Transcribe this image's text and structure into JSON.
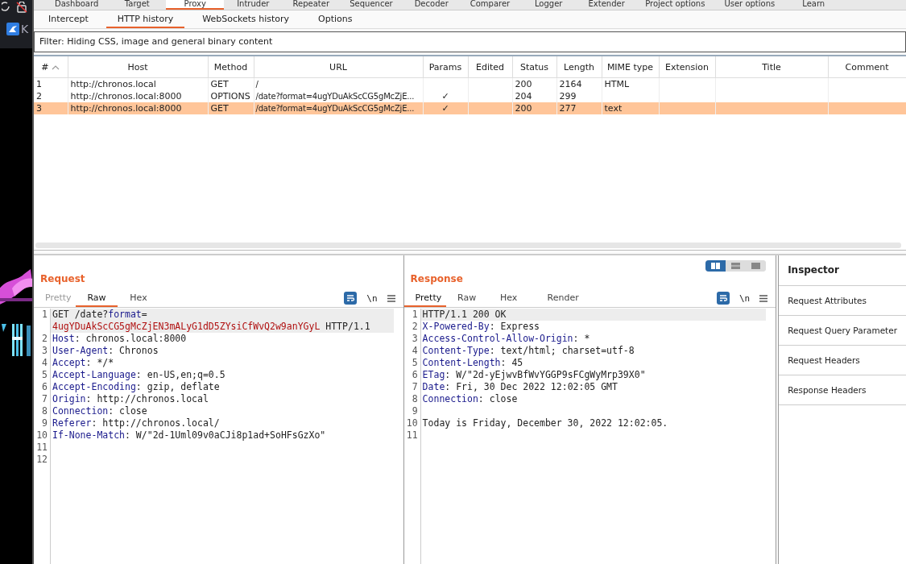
{
  "desktop": {
    "app_label": "K"
  },
  "main_tabs": [
    {
      "label": "Dashboard",
      "selected": false
    },
    {
      "label": "Target",
      "selected": false
    },
    {
      "label": "Proxy",
      "selected": true
    },
    {
      "label": "Intruder",
      "selected": false
    },
    {
      "label": "Repeater",
      "selected": false
    },
    {
      "label": "Sequencer",
      "selected": false
    },
    {
      "label": "Decoder",
      "selected": false
    },
    {
      "label": "Comparer",
      "selected": false
    },
    {
      "label": "Logger",
      "selected": false
    },
    {
      "label": "Extender",
      "selected": false
    },
    {
      "label": "Project options",
      "selected": false
    },
    {
      "label": "User options",
      "selected": false
    },
    {
      "label": "Learn",
      "selected": false
    }
  ],
  "sub_tabs": [
    {
      "label": "Intercept",
      "selected": false
    },
    {
      "label": "HTTP history",
      "selected": true
    },
    {
      "label": "WebSockets history",
      "selected": false
    },
    {
      "label": "Options",
      "selected": false
    }
  ],
  "filter": "Filter: Hiding CSS, image and general binary content",
  "table": {
    "columns": [
      "#",
      "Host",
      "Method",
      "URL",
      "Params",
      "Edited",
      "Status",
      "Length",
      "MIME type",
      "Extension",
      "Title",
      "Comment"
    ],
    "rows": [
      {
        "selected": false,
        "cells": [
          "1",
          "http://chronos.local",
          "GET",
          "/",
          null,
          null,
          "200",
          "2164",
          "HTML",
          null,
          null,
          null
        ]
      },
      {
        "selected": false,
        "cells": [
          "2",
          "http://chronos.local:8000",
          "OPTIONS",
          "/date?format=4ugYDuAkScCG5gMcZjE...",
          "✓",
          null,
          "204",
          "299",
          null,
          null,
          null,
          null
        ]
      },
      {
        "selected": true,
        "cells": [
          "3",
          "http://chronos.local:8000",
          "GET",
          "/date?format=4ugYDuAkScCG5gMcZjE...",
          "✓",
          null,
          "200",
          "277",
          "text",
          null,
          null,
          null
        ]
      }
    ]
  },
  "layout_toggle": [
    {
      "selected": true
    },
    {
      "selected": false
    },
    {
      "selected": false
    }
  ],
  "request": {
    "title": "Request",
    "tabs": [
      {
        "label": "Pretty",
        "selected": false,
        "disabled": true
      },
      {
        "label": "Raw",
        "selected": true,
        "disabled": false
      },
      {
        "label": "Hex",
        "selected": false,
        "disabled": false
      }
    ],
    "newline_toggle": "\\n",
    "lines": [
      {
        "number": "1",
        "current": true,
        "segments": [
          {
            "kind": "plain",
            "text": "GET /date?"
          },
          {
            "kind": "key",
            "text": "format"
          },
          {
            "kind": "plain",
            "text": "="
          },
          {
            "kind": "param",
            "text": "4ugYDuAkScCG5gMcZjEN3mALyG1dD5ZYsiCfWvQ2w9anYGyL"
          },
          {
            "kind": "plain",
            "text": " HTTP/1.1"
          }
        ]
      },
      {
        "number": "2",
        "current": false,
        "segments": [
          {
            "kind": "key",
            "text": "Host"
          },
          {
            "kind": "plain",
            "text": ": chronos.local:8000"
          }
        ]
      },
      {
        "number": "3",
        "current": false,
        "segments": [
          {
            "kind": "key",
            "text": "User-Agent"
          },
          {
            "kind": "plain",
            "text": ": Chronos"
          }
        ]
      },
      {
        "number": "4",
        "current": false,
        "segments": [
          {
            "kind": "key",
            "text": "Accept"
          },
          {
            "kind": "plain",
            "text": ": */*"
          }
        ]
      },
      {
        "number": "5",
        "current": false,
        "segments": [
          {
            "kind": "key",
            "text": "Accept-Language"
          },
          {
            "kind": "plain",
            "text": ": en-US,en;q=0.5"
          }
        ]
      },
      {
        "number": "6",
        "current": false,
        "segments": [
          {
            "kind": "key",
            "text": "Accept-Encoding"
          },
          {
            "kind": "plain",
            "text": ": gzip, deflate"
          }
        ]
      },
      {
        "number": "7",
        "current": false,
        "segments": [
          {
            "kind": "key",
            "text": "Origin"
          },
          {
            "kind": "plain",
            "text": ": http://chronos.local"
          }
        ]
      },
      {
        "number": "8",
        "current": false,
        "segments": [
          {
            "kind": "key",
            "text": "Connection"
          },
          {
            "kind": "plain",
            "text": ": close"
          }
        ]
      },
      {
        "number": "9",
        "current": false,
        "segments": [
          {
            "kind": "key",
            "text": "Referer"
          },
          {
            "kind": "plain",
            "text": ": http://chronos.local/"
          }
        ]
      },
      {
        "number": "10",
        "current": false,
        "segments": [
          {
            "kind": "key",
            "text": "If-None-Match"
          },
          {
            "kind": "plain",
            "text": ": W/\"2d-1Uml09v0aCJi8p1ad+SoHFsGzXo\""
          }
        ]
      },
      {
        "number": "11",
        "current": false
      },
      {
        "number": "12",
        "current": false
      }
    ]
  },
  "response": {
    "title": "Response",
    "tabs": [
      {
        "label": "Pretty",
        "selected": true,
        "disabled": false
      },
      {
        "label": "Raw",
        "selected": false,
        "disabled": false
      },
      {
        "label": "Hex",
        "selected": false,
        "disabled": false
      },
      {
        "label": "Render",
        "selected": false,
        "disabled": false
      }
    ],
    "newline_toggle": "\\n",
    "lines": [
      {
        "number": "1",
        "current": true,
        "segments": [
          {
            "kind": "plain",
            "text": "HTTP/1.1 200 OK"
          }
        ]
      },
      {
        "number": "2",
        "current": false,
        "segments": [
          {
            "kind": "key",
            "text": "X-Powered-By"
          },
          {
            "kind": "plain",
            "text": ": Express"
          }
        ]
      },
      {
        "number": "3",
        "current": false,
        "segments": [
          {
            "kind": "key",
            "text": "Access-Control-Allow-Origin"
          },
          {
            "kind": "plain",
            "text": ": *"
          }
        ]
      },
      {
        "number": "4",
        "current": false,
        "segments": [
          {
            "kind": "key",
            "text": "Content-Type"
          },
          {
            "kind": "plain",
            "text": ": text/html; charset=utf-8"
          }
        ]
      },
      {
        "number": "5",
        "current": false,
        "segments": [
          {
            "kind": "key",
            "text": "Content-Length"
          },
          {
            "kind": "plain",
            "text": ": 45"
          }
        ]
      },
      {
        "number": "6",
        "current": false,
        "segments": [
          {
            "kind": "key",
            "text": "ETag"
          },
          {
            "kind": "plain",
            "text": ": W/\"2d-yEjwvBfWvYGGP9sFCgWyMrp39X0\""
          }
        ]
      },
      {
        "number": "7",
        "current": false,
        "segments": [
          {
            "kind": "key",
            "text": "Date"
          },
          {
            "kind": "plain",
            "text": ": Fri, 30 Dec 2022 12:02:05 GMT"
          }
        ]
      },
      {
        "number": "8",
        "current": false,
        "segments": [
          {
            "kind": "key",
            "text": "Connection"
          },
          {
            "kind": "plain",
            "text": ": close"
          }
        ]
      },
      {
        "number": "9",
        "current": false
      },
      {
        "number": "10",
        "current": false,
        "segments": [
          {
            "kind": "plain",
            "text": "Today is Friday, December 30, 2022 12:02:05."
          }
        ]
      },
      {
        "number": "11",
        "current": false
      }
    ]
  },
  "inspector": {
    "title": "Inspector",
    "items": [
      "Request Attributes",
      "Request Query Parameter",
      "Request Headers",
      "Response Headers"
    ]
  }
}
